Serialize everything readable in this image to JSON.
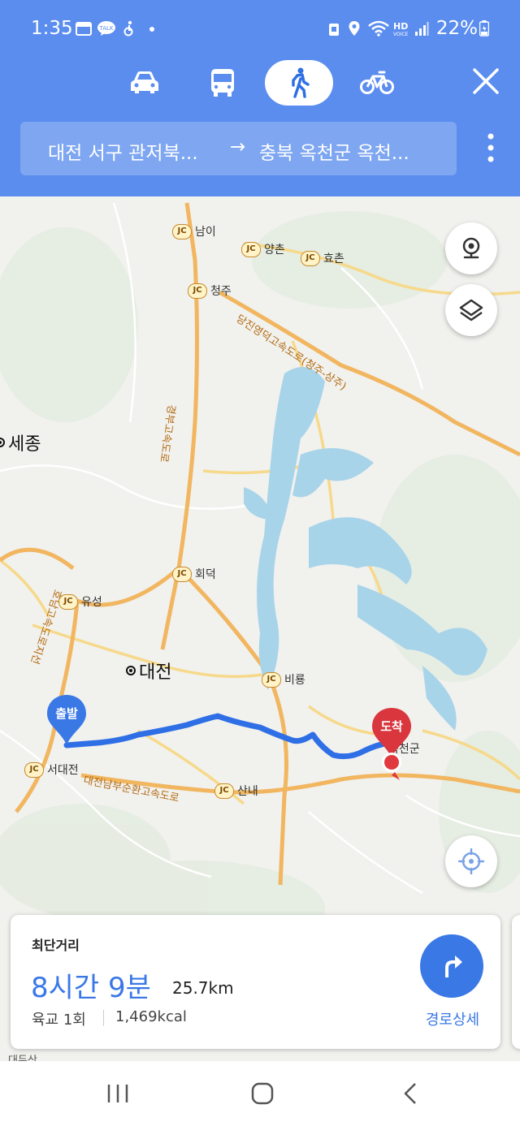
{
  "status_bar": {
    "time": "1:35",
    "battery": "22%",
    "icons": [
      "calendar-icon",
      "talk-icon",
      "accessibility-icon",
      "dot-icon",
      "lock-icon",
      "location-icon",
      "wifi-icon",
      "hd-voice-icon",
      "signal-icon",
      "battery-icon"
    ]
  },
  "header": {
    "modes": [
      {
        "name": "car-icon",
        "selected": false
      },
      {
        "name": "bus-icon",
        "selected": false
      },
      {
        "name": "walk-icon",
        "selected": true
      },
      {
        "name": "bike-icon",
        "selected": false
      }
    ],
    "close_icon": "close-icon",
    "origin": "대전 서구 관저북...",
    "arrow": "→",
    "destination": "충북 옥천군 옥천...",
    "menu_icon": "more-vert-icon",
    "colors": {
      "header_bg": "#5b8def",
      "route_box": "#7ea6f1"
    }
  },
  "map": {
    "junctions": [
      "남이",
      "양촌",
      "효촌",
      "청주",
      "회덕",
      "유성",
      "비룡",
      "서대전",
      "산내"
    ],
    "jc_badge": "JC",
    "cities": [
      "세종",
      "대전"
    ],
    "towns": [
      "옥천군"
    ],
    "roads": [
      "당진영덕고속도로(청주-상주)",
      "경부고속도로",
      "호남고속도로지선",
      "대전남부순환고속도로"
    ],
    "partial_labels": [
      "대두산"
    ],
    "start_marker": "출발",
    "end_marker": "도착",
    "buttons": [
      "street-view-icon",
      "layers-icon",
      "my-location-icon"
    ],
    "colors": {
      "route": "#2f6fe6",
      "water": "#a8d4ea",
      "road_major": "#f4c96a",
      "start": "#3a78e6",
      "end": "#d9363e"
    }
  },
  "card": {
    "title": "최단거리",
    "duration": "8시간 9분",
    "distance": "25.7km",
    "crossing": "육교 1회",
    "calories": "1,469kcal",
    "nav_label": "경로상세",
    "nav_icon": "turn-right-icon"
  },
  "navbar": {
    "buttons": [
      "recents-icon",
      "home-icon",
      "back-icon"
    ]
  }
}
